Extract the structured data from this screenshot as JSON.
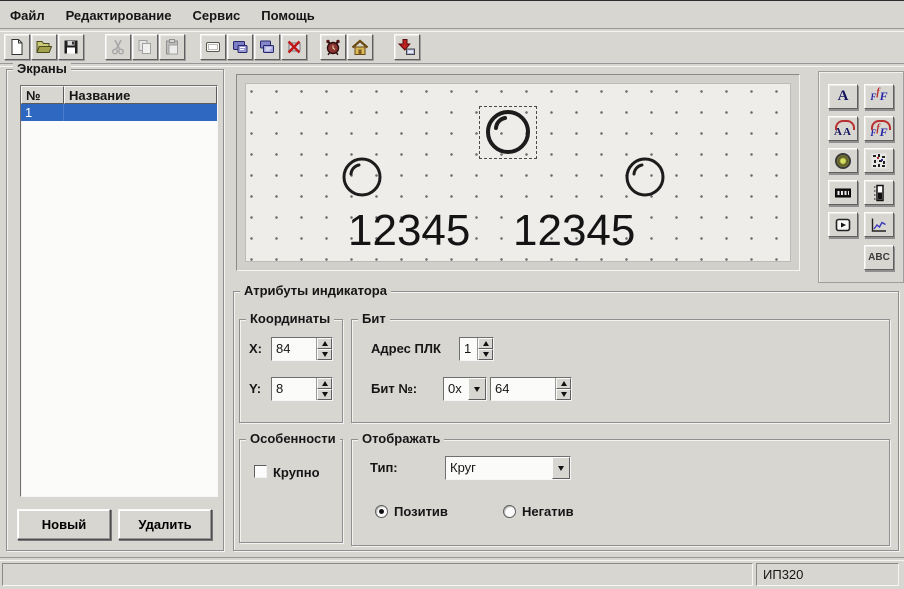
{
  "menu": {
    "items": [
      "Файл",
      "Редактирование",
      "Сервис",
      "Помощь"
    ]
  },
  "toolbar": {
    "icons": [
      "new-document",
      "open-folder",
      "save-floppy",
      "cut-scissors",
      "copy-pages",
      "paste-clipboard",
      "new-screen",
      "screen-properties",
      "copy-screen",
      "delete-screen",
      "alarm-clock",
      "home-screen",
      "download-to-panel"
    ]
  },
  "screens": {
    "caption": "Экраны",
    "columns": [
      "№",
      "Название"
    ],
    "rows": [
      {
        "num": "1",
        "name": ""
      }
    ],
    "new_label": "Новый",
    "delete_label": "Удалить"
  },
  "canvas": {
    "texts": [
      "12345",
      "12345"
    ],
    "indicator_shape": "circle",
    "selected_indicator": "top-center"
  },
  "palette": {
    "a": "A",
    "aa": "AA",
    "f1": "F",
    "f2": "f",
    "f3": "F",
    "abc": "ABC",
    "icons": [
      "static-text",
      "font-function",
      "dynamic-text",
      "dynamic-function",
      "indicator-lamp",
      "bitmap",
      "register-display",
      "bargraph",
      "video-play",
      "trend-graph",
      "text-abc"
    ]
  },
  "attributes": {
    "caption": "Атрибуты индикатора",
    "coords": {
      "caption": "Координаты",
      "x_label": "X:",
      "x_value": "84",
      "y_label": "Y:",
      "y_value": "8"
    },
    "bit": {
      "caption": "Бит",
      "plc_label": "Адрес ПЛК",
      "plc_value": "1",
      "bit_label": "Бит №:",
      "base_value": "0x",
      "bit_value": "64"
    },
    "features": {
      "caption": "Особенности",
      "big_label": "Крупно",
      "big_checked": false
    },
    "display": {
      "caption": "Отображать",
      "type_label": "Тип:",
      "type_value": "Круг",
      "positive_label": "Позитив",
      "negative_label": "Негатив",
      "selected": "positive"
    }
  },
  "statusbar": {
    "left": "",
    "device": "ИП320"
  },
  "colors": {
    "window_bg": "#d8d6d1",
    "canvas_bg": "#eeede9",
    "selection_blue": "#2e68c0",
    "accent_red": "#c02020"
  }
}
